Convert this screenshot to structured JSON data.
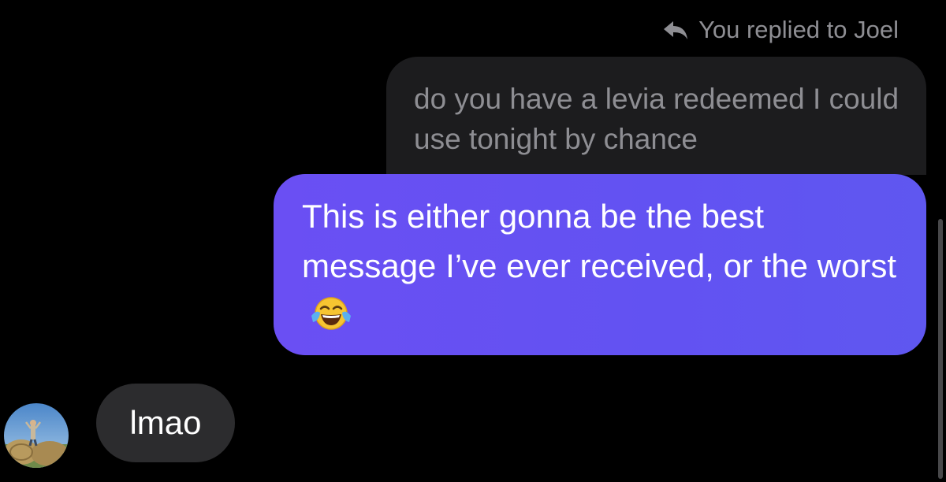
{
  "reply_header": {
    "icon": "reply-arrow-icon",
    "text": "You replied to Joel"
  },
  "quoted_message": {
    "text": "do you have a levia redeemed I could use tonight by chance"
  },
  "sent_message": {
    "text": "This is either gonna be the best message I’ve ever received, or the worst",
    "emoji": "face-with-tears-of-joy-icon",
    "bubble_color": "#6252f2"
  },
  "received_message": {
    "text": "lmao",
    "avatar": "contact-avatar-photo"
  },
  "colors": {
    "background": "#000000",
    "quoted_bubble": "#1c1c1e",
    "received_bubble": "#2c2c2e",
    "meta_text": "#8e8e93"
  }
}
